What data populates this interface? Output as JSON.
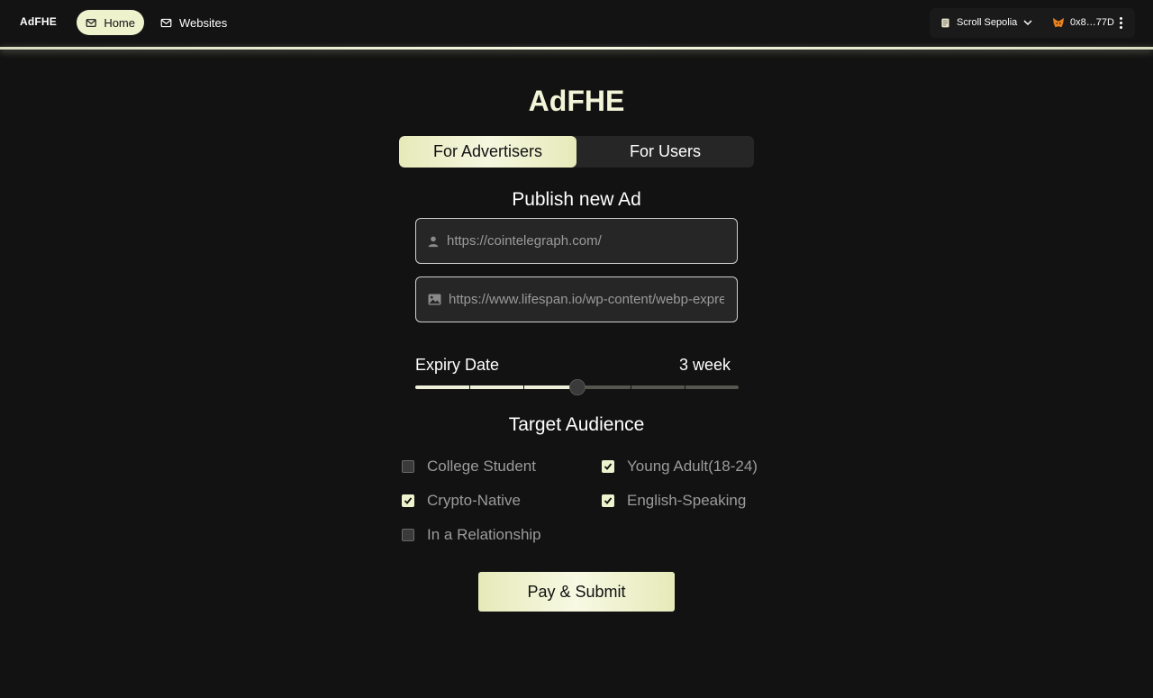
{
  "header": {
    "brand": "AdFHE",
    "nav": {
      "home": "Home",
      "websites": "Websites"
    },
    "network": "Scroll Sepolia",
    "account": "0x8…77D"
  },
  "main": {
    "title": "AdFHE",
    "tabs": [
      "For Advertisers",
      "For Users"
    ],
    "active_tab": "For Advertisers",
    "publish": {
      "heading": "Publish new Ad",
      "site_url": "https://cointelegraph.com/",
      "image_url": "https://www.lifespan.io/wp-content/webp-express"
    },
    "expiry": {
      "label": "Expiry Date",
      "value": "3 week",
      "steps": 7,
      "selected_index": 3
    },
    "audience": {
      "heading": "Target Audience",
      "options": [
        {
          "label": "College Student",
          "checked": false
        },
        {
          "label": "Young Adult(18-24)",
          "checked": true
        },
        {
          "label": "Crypto-Native",
          "checked": true
        },
        {
          "label": "English-Speaking",
          "checked": true
        },
        {
          "label": "In a Relationship",
          "checked": false
        }
      ]
    },
    "submit_label": "Pay & Submit"
  },
  "colors": {
    "accent": "#eef2cd",
    "background": "#121212"
  }
}
